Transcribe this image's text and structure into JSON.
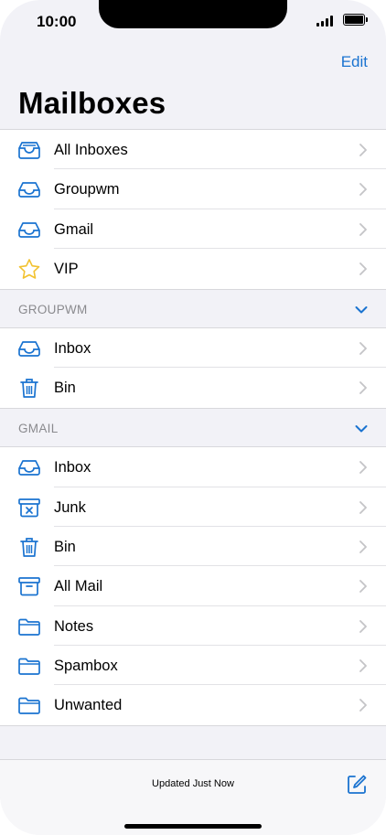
{
  "status": {
    "time": "10:00"
  },
  "nav": {
    "edit_label": "Edit",
    "title": "Mailboxes"
  },
  "top_items": [
    {
      "label": "All Inboxes",
      "icon": "all-inboxes-icon"
    },
    {
      "label": "Groupwm",
      "icon": "inbox-icon"
    },
    {
      "label": "Gmail",
      "icon": "inbox-icon"
    },
    {
      "label": "VIP",
      "icon": "star-icon"
    }
  ],
  "sections": [
    {
      "title": "GROUPWM",
      "items": [
        {
          "label": "Inbox",
          "icon": "inbox-icon"
        },
        {
          "label": "Bin",
          "icon": "trash-icon"
        }
      ]
    },
    {
      "title": "GMAIL",
      "items": [
        {
          "label": "Inbox",
          "icon": "inbox-icon"
        },
        {
          "label": "Junk",
          "icon": "junk-icon"
        },
        {
          "label": "Bin",
          "icon": "trash-icon"
        },
        {
          "label": "All Mail",
          "icon": "archive-icon"
        },
        {
          "label": "Notes",
          "icon": "folder-icon"
        },
        {
          "label": "Spambox",
          "icon": "folder-icon"
        },
        {
          "label": "Unwanted",
          "icon": "folder-icon"
        }
      ]
    }
  ],
  "toolbar": {
    "updated_text": "Updated Just Now"
  },
  "colors": {
    "accent": "#1a73d0",
    "star": "#f2c230",
    "chevron": "#c4c4c7",
    "section_text": "#8a8a8e"
  }
}
